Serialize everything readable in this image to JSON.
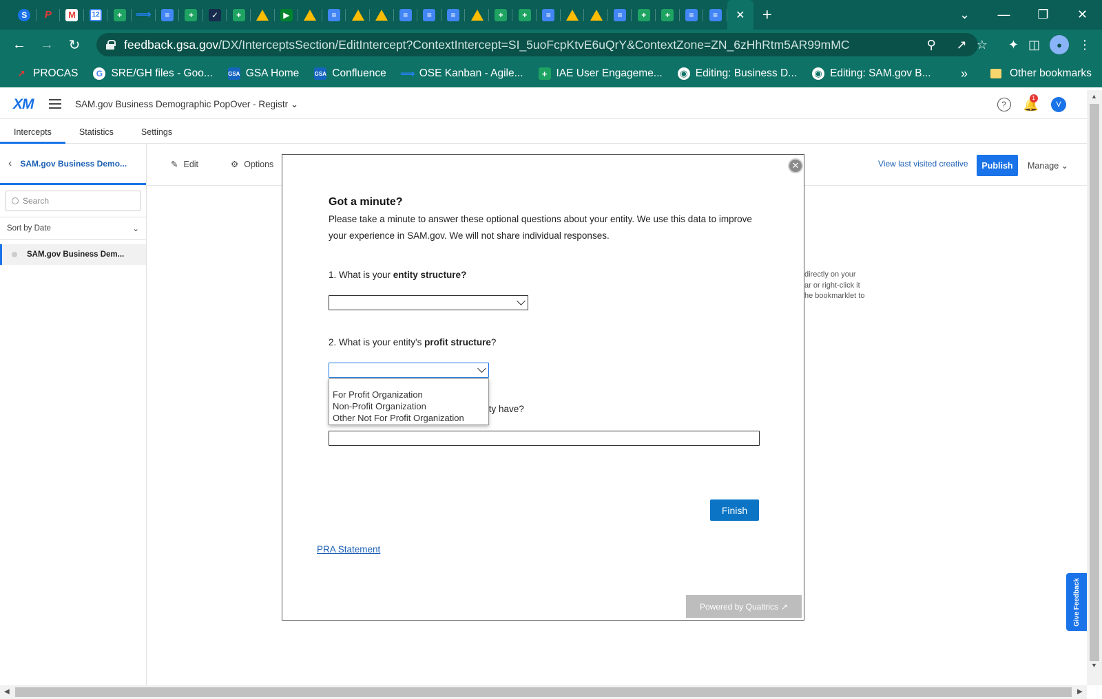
{
  "browser": {
    "tab_favicons": [
      "sam",
      "proc",
      "gmail",
      "cal",
      "sheets",
      "jira",
      "docs",
      "sheets",
      "check",
      "sheets",
      "drive",
      "meet",
      "drive",
      "docs",
      "drive",
      "drive",
      "docs",
      "docs",
      "docs",
      "drive",
      "sheets",
      "sheets",
      "docs",
      "drive",
      "drive",
      "docs",
      "sheets",
      "sheets",
      "docs",
      "docs"
    ],
    "active_tab_close": "✕",
    "new_tab": "+",
    "window_controls": {
      "tab_search": "⌄",
      "minimize": "—",
      "restore": "❐",
      "close": "✕"
    },
    "url_host": "feedback.gsa.gov",
    "url_path": "/DX/InterceptsSection/EditIntercept?ContextIntercept=SI_5uoFcpKtvE6uQrY&ContextZone=ZN_6zHhRtm5AR99mMC",
    "bookmarks": [
      {
        "label": "PROCAS",
        "icon": "red"
      },
      {
        "label": "SRE/GH files - Goo...",
        "icon": "goog"
      },
      {
        "label": "GSA Home",
        "icon": "gsa"
      },
      {
        "label": "Confluence",
        "icon": "gsa"
      },
      {
        "label": "OSE Kanban - Agile...",
        "icon": "jira"
      },
      {
        "label": "IAE User Engageme...",
        "icon": "sheets"
      },
      {
        "label": "Editing: Business D...",
        "icon": "globe"
      },
      {
        "label": "Editing: SAM.gov B...",
        "icon": "globe"
      }
    ],
    "bookmarks_more": "»",
    "other_bookmarks": "Other bookmarks"
  },
  "app": {
    "logo": "XM",
    "project_title": "SAM.gov Business Demographic PopOver - Registr",
    "user_initial": "V",
    "notification_count": "1",
    "tabs": [
      "Intercepts",
      "Statistics",
      "Settings"
    ],
    "left_pane": {
      "back_title": "SAM.gov Business Demo...",
      "search_placeholder": "Search",
      "sort_label": "Sort by Date",
      "items": [
        "SAM.gov Business Dem..."
      ]
    },
    "toolbar": {
      "edit": "Edit",
      "options": "Options",
      "view_last": "View last visited creative",
      "publish": "Publish",
      "manage": "Manage"
    },
    "background_hint": [
      "directly on your",
      "ar or right-click it",
      "he bookmarklet to"
    ],
    "feedback_tab": "Give Feedback"
  },
  "modal": {
    "title": "Got a minute?",
    "intro": "Please take a minute to answer these optional questions about your entity. We use this data to improve your experience in SAM.gov. We will not share individual responses.",
    "q1_prefix": "1. What is your ",
    "q1_bold": "entity structure?",
    "q2_prefix": "2. What is your entity's ",
    "q2_bold": "profit structure",
    "q2_suffix": "?",
    "q3_visible": "tity have?",
    "profit_options": [
      "For Profit Organization",
      "Non-Profit Organization",
      "Other Not For Profit Organization"
    ],
    "finish": "Finish",
    "pra": "PRA Statement",
    "powered_by": "Powered by Qualtrics"
  }
}
